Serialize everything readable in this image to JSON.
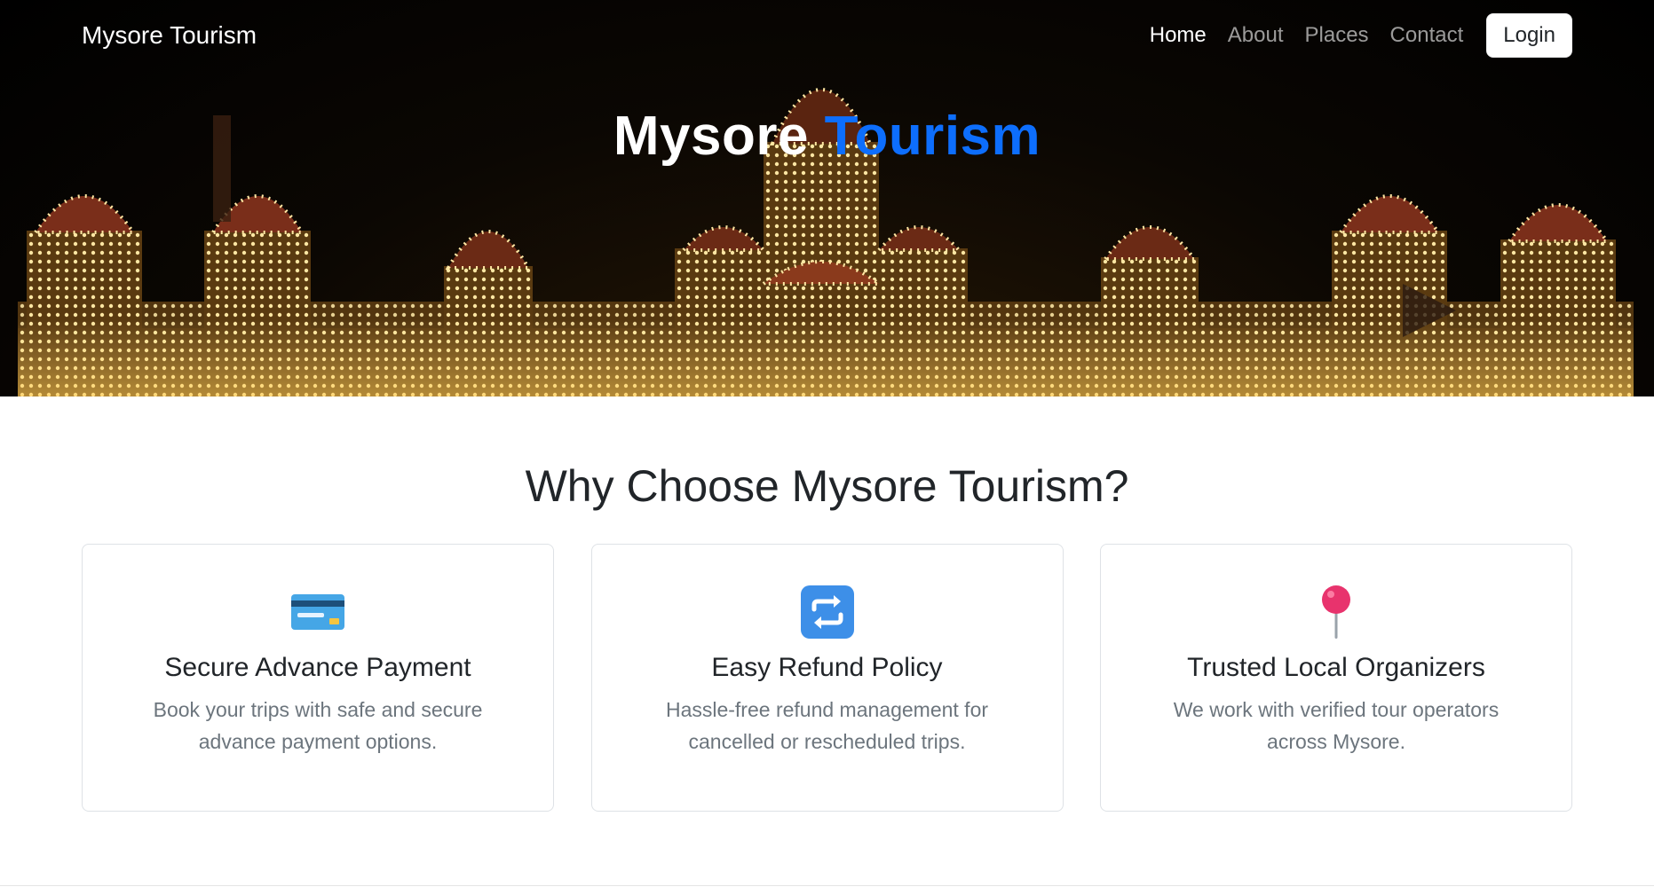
{
  "navbar": {
    "brand": "Mysore Tourism",
    "links": [
      {
        "label": "Home",
        "active": true
      },
      {
        "label": "About"
      },
      {
        "label": "Places"
      },
      {
        "label": "Contact"
      }
    ],
    "login_label": "Login"
  },
  "hero": {
    "title_part1": "Mysore",
    "title_part2": "Tourism",
    "accent_color": "#0d6efd"
  },
  "features": {
    "title": "Why Choose Mysore Tourism?",
    "cards": [
      {
        "icon": "credit-card-icon",
        "title": "Secure Advance Payment",
        "text": "Book your trips with safe and secure advance payment options."
      },
      {
        "icon": "repeat-arrows-icon",
        "title": "Easy Refund Policy",
        "text": "Hassle-free refund management for cancelled or rescheduled trips."
      },
      {
        "icon": "pushpin-icon",
        "title": "Trusted Local Organizers",
        "text": "We work with verified tour operators across Mysore."
      }
    ]
  }
}
